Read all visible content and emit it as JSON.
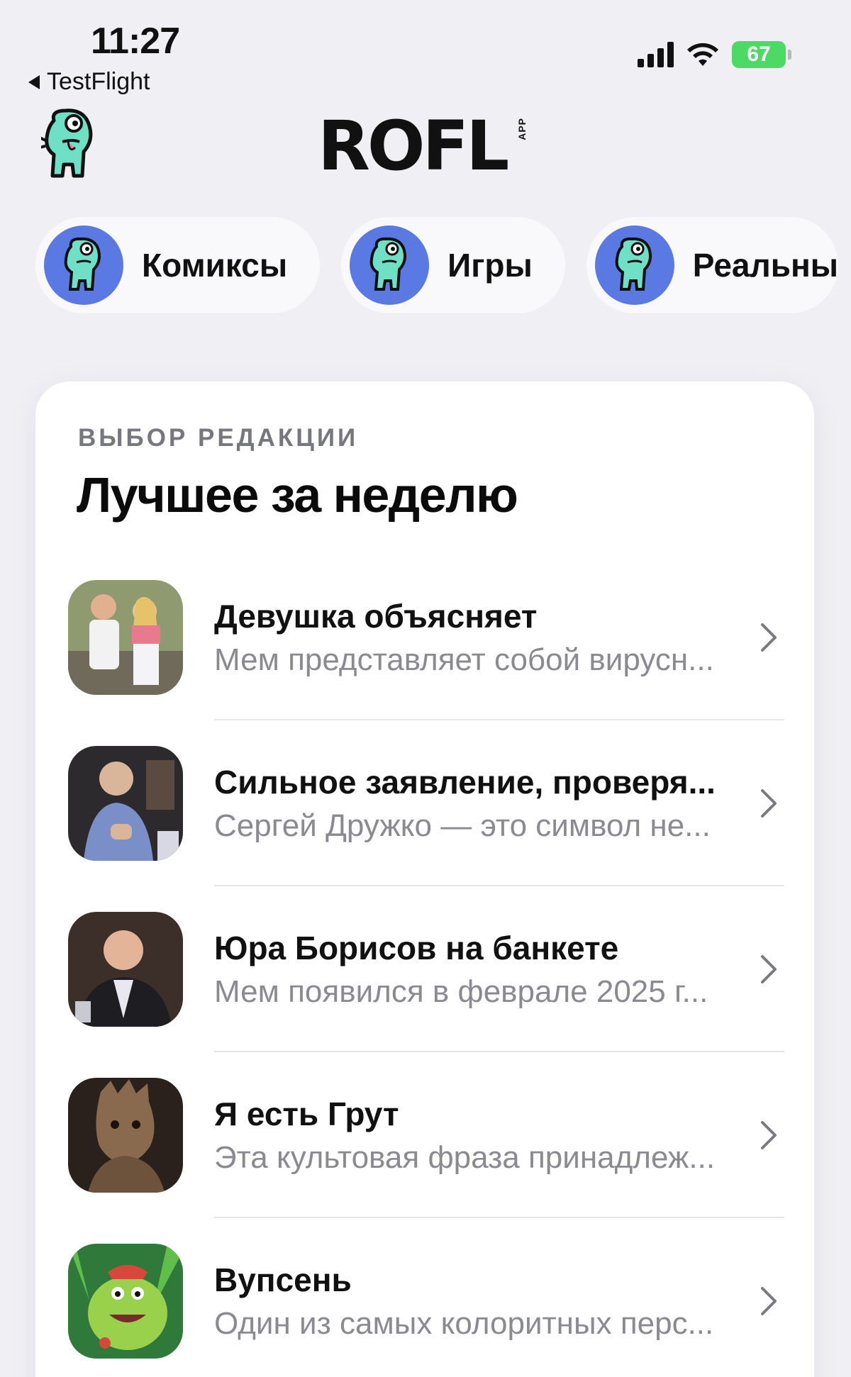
{
  "status": {
    "time": "11:27",
    "back_app": "TestFlight",
    "battery": "67"
  },
  "header": {
    "logo": "ROFL",
    "logo_badge": "APP"
  },
  "categories": [
    {
      "label": "Комиксы"
    },
    {
      "label": "Игры"
    },
    {
      "label": "Реальны"
    }
  ],
  "featured": {
    "eyebrow": "ВЫБОР РЕДАКЦИИ",
    "title": "Лучшее за неделю",
    "items": [
      {
        "title": "Девушка объясняет",
        "subtitle": "Мем представляет собой вирусн..."
      },
      {
        "title": "Сильное заявление, проверя...",
        "subtitle": "Сергей Дружко — это символ не..."
      },
      {
        "title": "Юра Борисов на банкете",
        "subtitle": "Мем появился в феврале 2025 г..."
      },
      {
        "title": "Я есть Грут",
        "subtitle": "Эта культовая фраза принадлеж..."
      },
      {
        "title": "Вупсень",
        "subtitle": "Один из самых колоритных перс..."
      }
    ]
  },
  "colors": {
    "accent_blue": "#5b79e3",
    "mascot_teal": "#6fe0c6",
    "battery_green": "#4cd964"
  }
}
